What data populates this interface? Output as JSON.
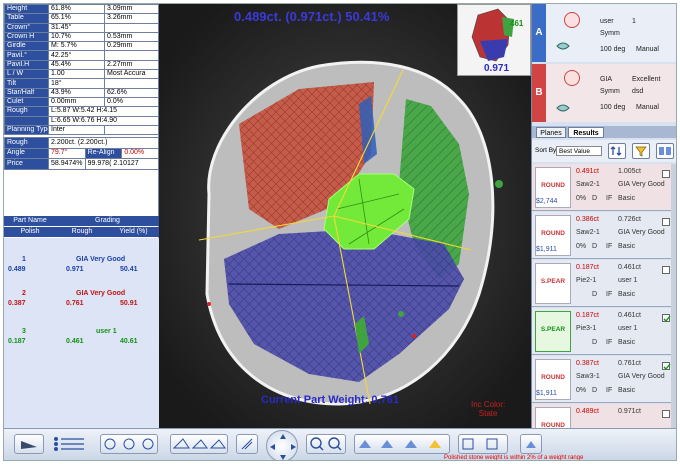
{
  "measure_rows": [
    {
      "label": "Height",
      "v1": "61.8%",
      "v2": "3.09mm"
    },
    {
      "label": "Table",
      "v1": "65.1%",
      "v2": "3.26mm"
    },
    {
      "label": "Crown°",
      "v1": "31.45°",
      "v2": ""
    },
    {
      "label": "Crown H",
      "v1": "10.7%",
      "v2": "0.53mm"
    },
    {
      "label": "Girdle",
      "v1": "M: 5.7%",
      "v2": "0.29mm"
    },
    {
      "label": "Pavil.°",
      "v1": "42.25°",
      "v2": ""
    },
    {
      "label": "Pavil.H",
      "v1": "45.4%",
      "v2": "2.27mm"
    },
    {
      "label": "L / W",
      "v1": "1.00",
      "v2": "Most Accura"
    },
    {
      "label": "Tilt",
      "v1": "18°",
      "v2": ""
    },
    {
      "label": "Star/Half",
      "v1": "43.9%",
      "v2": "62.6%"
    },
    {
      "label": "Culet",
      "v1": "0.00mm",
      "v2": "0.0%"
    },
    {
      "label": "Rough",
      "v1": "L:5.87 W:5.42 H:4.15",
      "v2": ""
    },
    {
      "label": "",
      "v1": "L:6.65 W:6.76 H:4.90",
      "v2": ""
    },
    {
      "label": "Planning Type",
      "v1": "Inter",
      "v2": ""
    }
  ],
  "rough": {
    "label": "Rough",
    "value": "2.200ct. (2.200ct.)",
    "angle_label": "Angle",
    "angle_value": "79.7°",
    "realign_label": "Re-Align",
    "realign_value": "0.00%",
    "price_label": "Price",
    "price_v1": "58.9474%",
    "price_v2": "99.978( 2.10127"
  },
  "grading_header": {
    "part_name": "Part Name",
    "grading": "Grading",
    "polish": "Polish",
    "rough": "Rough",
    "yield": "Yield (%)"
  },
  "plans": [
    {
      "num": "1",
      "grade": "GIA Very Good",
      "polish": "0.489",
      "rough": "0.971",
      "yield": "50.41",
      "color": "#1a3fa8"
    },
    {
      "num": "2",
      "grade": "GIA Very Good",
      "polish": "0.387",
      "rough": "0.761",
      "yield": "50.91",
      "color": "#c01515"
    },
    {
      "num": "3",
      "grade": "user 1",
      "polish": "0.187",
      "rough": "0.461",
      "yield": "40.61",
      "color": "#159015"
    }
  ],
  "view": {
    "title": "0.489ct. (0.971ct.) 50.41%",
    "current_weight": "Current Part Weight: 0.761",
    "inc_color_label": "Inc Color:",
    "inc_color_value": "State",
    "thumb_label_top": "461",
    "thumb_label_bottom": "0.971"
  },
  "cards": [
    {
      "badge": "A",
      "color": "#3b6dc6",
      "c1": "user",
      "c2": "1",
      "c3": "Symm",
      "c4": "100 deg",
      "c5": "Manual"
    },
    {
      "badge": "B",
      "color": "#d04444",
      "c1": "GIA",
      "c2": "Excellent",
      "c3": "Symm",
      "c4": "dsd",
      "c5": "100 deg",
      "c6": "Manual"
    }
  ],
  "right_tabs": {
    "planes": "Planes",
    "results": "Results"
  },
  "sort": {
    "label": "Sort By:",
    "value": "Best Value"
  },
  "results": [
    {
      "shape": "ROUND",
      "polish": "0.491ct",
      "rough": "1.005ct",
      "name": "Saw2-1",
      "grade": "GIA Very Good",
      "price": "$2,744",
      "col": "0%",
      "clar": "D",
      "cla2": "IF",
      "type": "Basic",
      "hl": true,
      "checked": false
    },
    {
      "shape": "ROUND",
      "polish": "0.386ct",
      "rough": "0.726ct",
      "name": "Saw2-1",
      "grade": "GIA Very Good",
      "price": "$1,911",
      "col": "0%",
      "clar": "D",
      "cla2": "IF",
      "type": "Basic",
      "hl": false,
      "checked": false
    },
    {
      "shape": "S.PEAR",
      "polish": "0.187ct",
      "rough": "0.461ct",
      "name": "Pie2-1",
      "grade": "user 1",
      "price": "",
      "col": "",
      "clar": "D",
      "cla2": "IF",
      "type": "Basic",
      "hl": false,
      "checked": false
    },
    {
      "shape": "S.PEAR",
      "polish": "0.187ct",
      "rough": "0.461ct",
      "name": "Pie3-1",
      "grade": "user 1",
      "price": "",
      "col": "",
      "clar": "D",
      "cla2": "IF",
      "type": "Basic",
      "hl": false,
      "checked": true
    },
    {
      "shape": "ROUND",
      "polish": "0.387ct",
      "rough": "0.761ct",
      "name": "Saw3-1",
      "grade": "GIA Very Good",
      "price": "$1,911",
      "col": "0%",
      "clar": "D",
      "cla2": "IF",
      "type": "Basic",
      "hl": false,
      "checked": true
    },
    {
      "shape": "ROUND",
      "polish": "0.489ct",
      "rough": "0.971ct",
      "name": "",
      "grade": "",
      "price": "",
      "col": "",
      "clar": "",
      "cla2": "",
      "type": "",
      "hl": true,
      "checked": false
    }
  ],
  "footnote": "Polished stone weight is within 2% of a weight range"
}
